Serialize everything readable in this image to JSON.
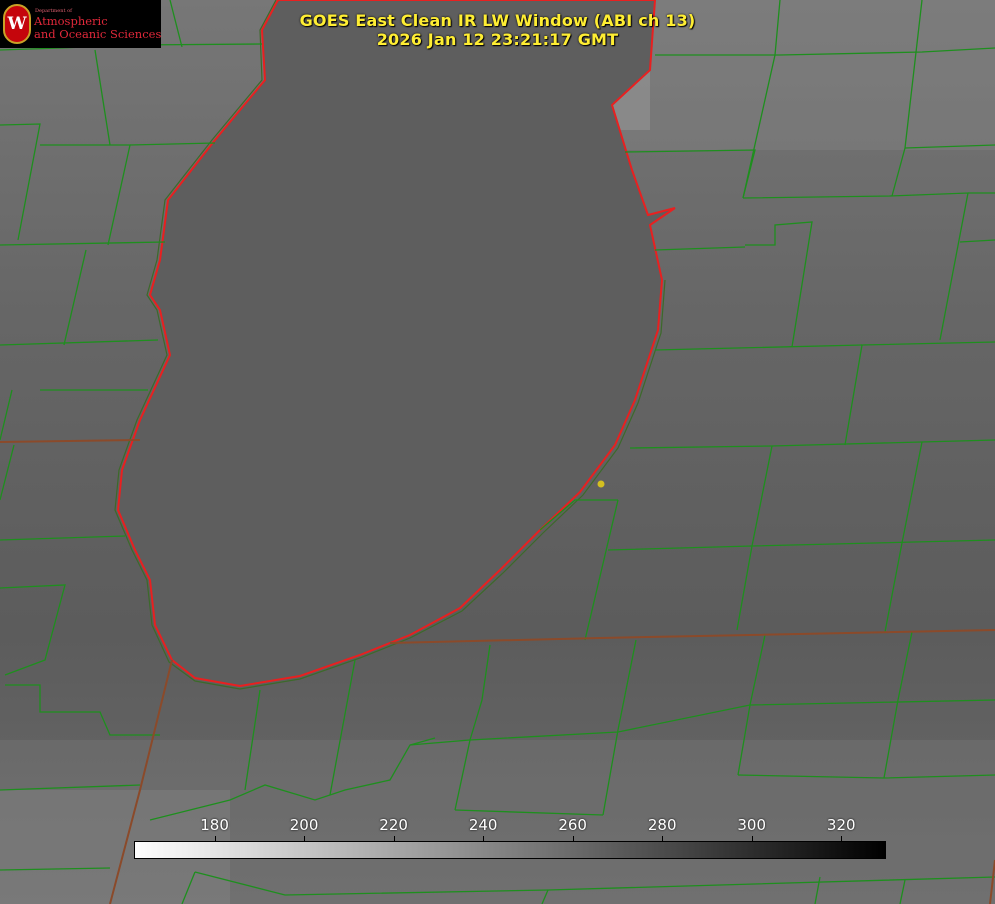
{
  "title": "GOES East Clean IR LW Window (ABI ch 13)",
  "timestamp": "2026 Jan 12 23:21:17 GMT",
  "logo": {
    "seal_letter": "W",
    "department": "Department of",
    "line1": "Atmospheric",
    "line2": "and Oceanic Sciences"
  },
  "colorbar": {
    "ticks": [
      "180",
      "200",
      "220",
      "240",
      "260",
      "280",
      "300",
      "320"
    ],
    "range": [
      162,
      330
    ],
    "colormap": "grayscale, white (cold) to black (warm)"
  },
  "colors": {
    "county_lines": "#1e8f1e",
    "state_lines": "#8b4a2a",
    "lake_outline": "#e82020",
    "title": "#ffee33",
    "marker": "#d4c020"
  }
}
